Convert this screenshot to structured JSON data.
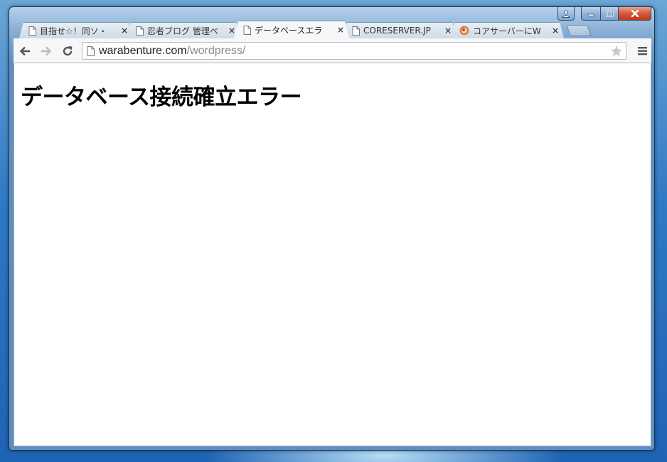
{
  "browser": {
    "tabs": [
      {
        "title": "目指せ☆！同ソ・",
        "icon": "page-icon",
        "active": false
      },
      {
        "title": "忍者ブログ 管理ペ",
        "icon": "page-icon",
        "active": false
      },
      {
        "title": "データベースエラ",
        "icon": "page-icon",
        "active": true
      },
      {
        "title": "CORESERVER.JP",
        "icon": "page-icon",
        "active": false
      },
      {
        "title": "コアサーバーにW",
        "icon": "coreserver-favicon",
        "active": false
      }
    ],
    "close_glyph": "×",
    "address": {
      "domain": "warabenture.com",
      "path": "/wordpress/"
    }
  },
  "page": {
    "heading": "データベース接続確立エラー"
  },
  "colors": {
    "desktop": "#2f78c4",
    "frame": "#6d9ccc",
    "close_button": "#c2371a",
    "toolbar": "#f6f7f9"
  }
}
